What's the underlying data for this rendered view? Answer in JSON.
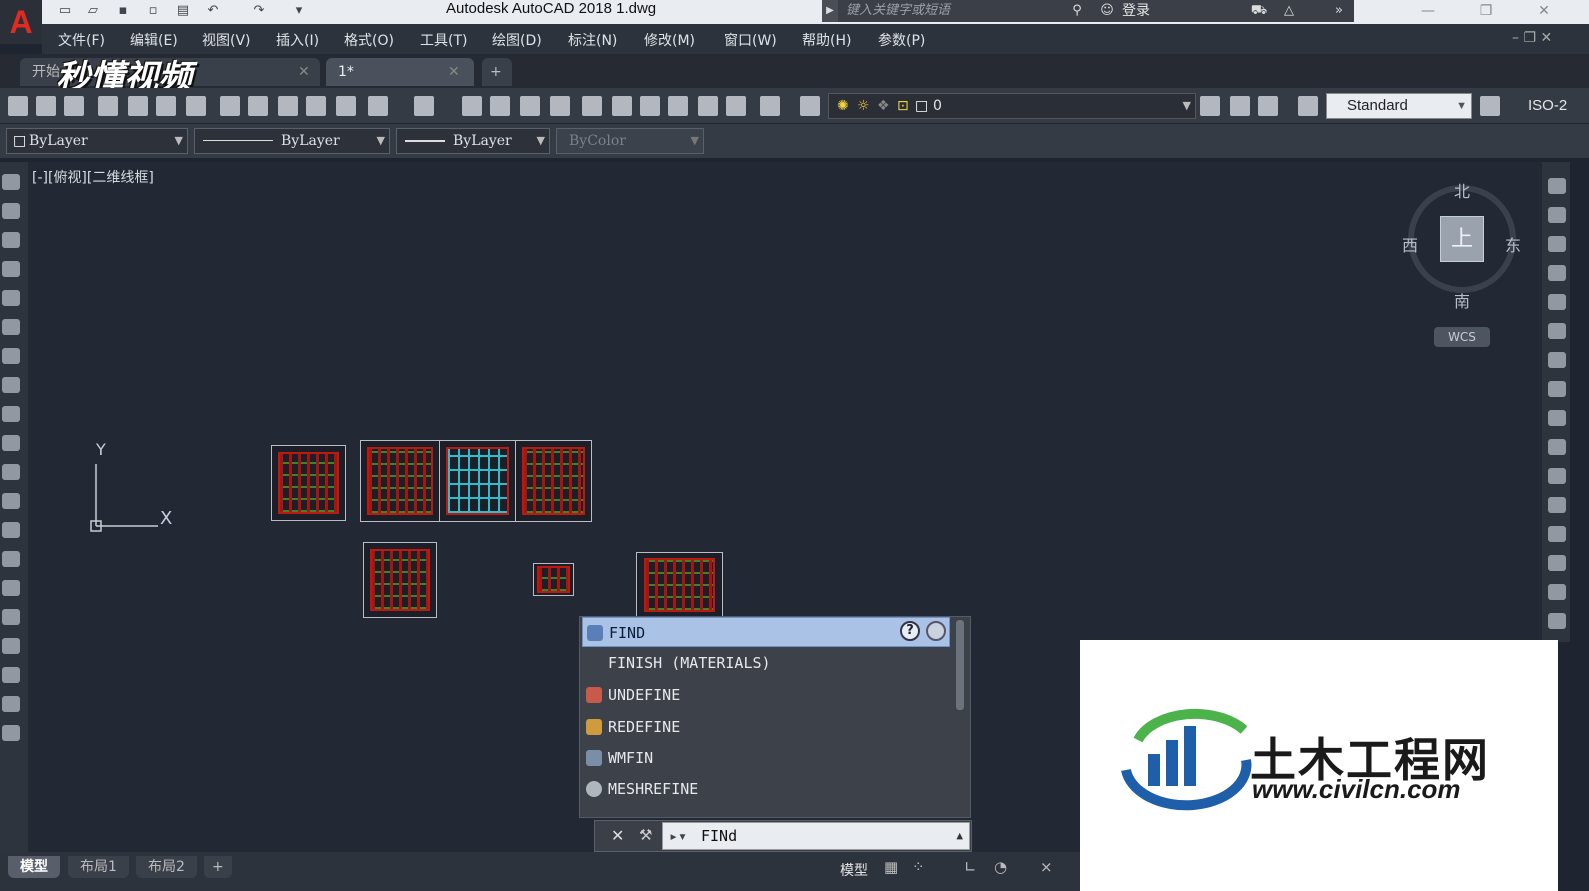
{
  "app": {
    "title": "Autodesk AutoCAD 2018    1.dwg",
    "logo_letter": "A",
    "search_placeholder": "键入关键字或短语",
    "login_label": "登录"
  },
  "window_controls": [
    "—",
    "❐",
    "✕"
  ],
  "menu": [
    "文件(F)",
    "编辑(E)",
    "视图(V)",
    "插入(I)",
    "格式(O)",
    "工具(T)",
    "绘图(D)",
    "标注(N)",
    "修改(M)",
    "窗口(W)",
    "帮助(H)",
    "参数(P)"
  ],
  "tabs": [
    {
      "label": "开始"
    },
    {
      "label": "1*"
    }
  ],
  "tab_add": "+",
  "watermark_top": "秒懂视频",
  "layer": {
    "current": "0"
  },
  "text_style": "Standard",
  "dim_style": "ISO-2",
  "properties": {
    "color": "ByLayer",
    "linetype": "ByLayer",
    "lineweight": "ByLayer",
    "plotstyle": "ByColor"
  },
  "viewport": {
    "label": "[-][俯视][二维线框]",
    "ucs_y": "Y",
    "ucs_x": "X"
  },
  "viewcube": {
    "face": "上",
    "north": "北",
    "south": "南",
    "east": "东",
    "west": "西",
    "wcs": "WCS"
  },
  "autocomplete": {
    "items": [
      {
        "label": "FIND",
        "selected": true
      },
      {
        "label": "FINISH (MATERIALS)",
        "selected": false
      },
      {
        "label": "UNDEFINE",
        "selected": false
      },
      {
        "label": "REDEFINE",
        "selected": false
      },
      {
        "label": "WMFIN",
        "selected": false
      },
      {
        "label": "MESHREFINE",
        "selected": false
      }
    ],
    "help_glyph": "?"
  },
  "command_line": {
    "input_value": "FINd",
    "close_glyph": "✕",
    "expand_glyph": "▲"
  },
  "layout_tabs": [
    {
      "label": "模型",
      "active": true
    },
    {
      "label": "布局1",
      "active": false
    },
    {
      "label": "布局2",
      "active": false
    }
  ],
  "layout_add": "+",
  "status": {
    "model_label": "模型"
  },
  "site_watermark": {
    "name": "土木工程网",
    "url": "www.civilcn.com"
  }
}
